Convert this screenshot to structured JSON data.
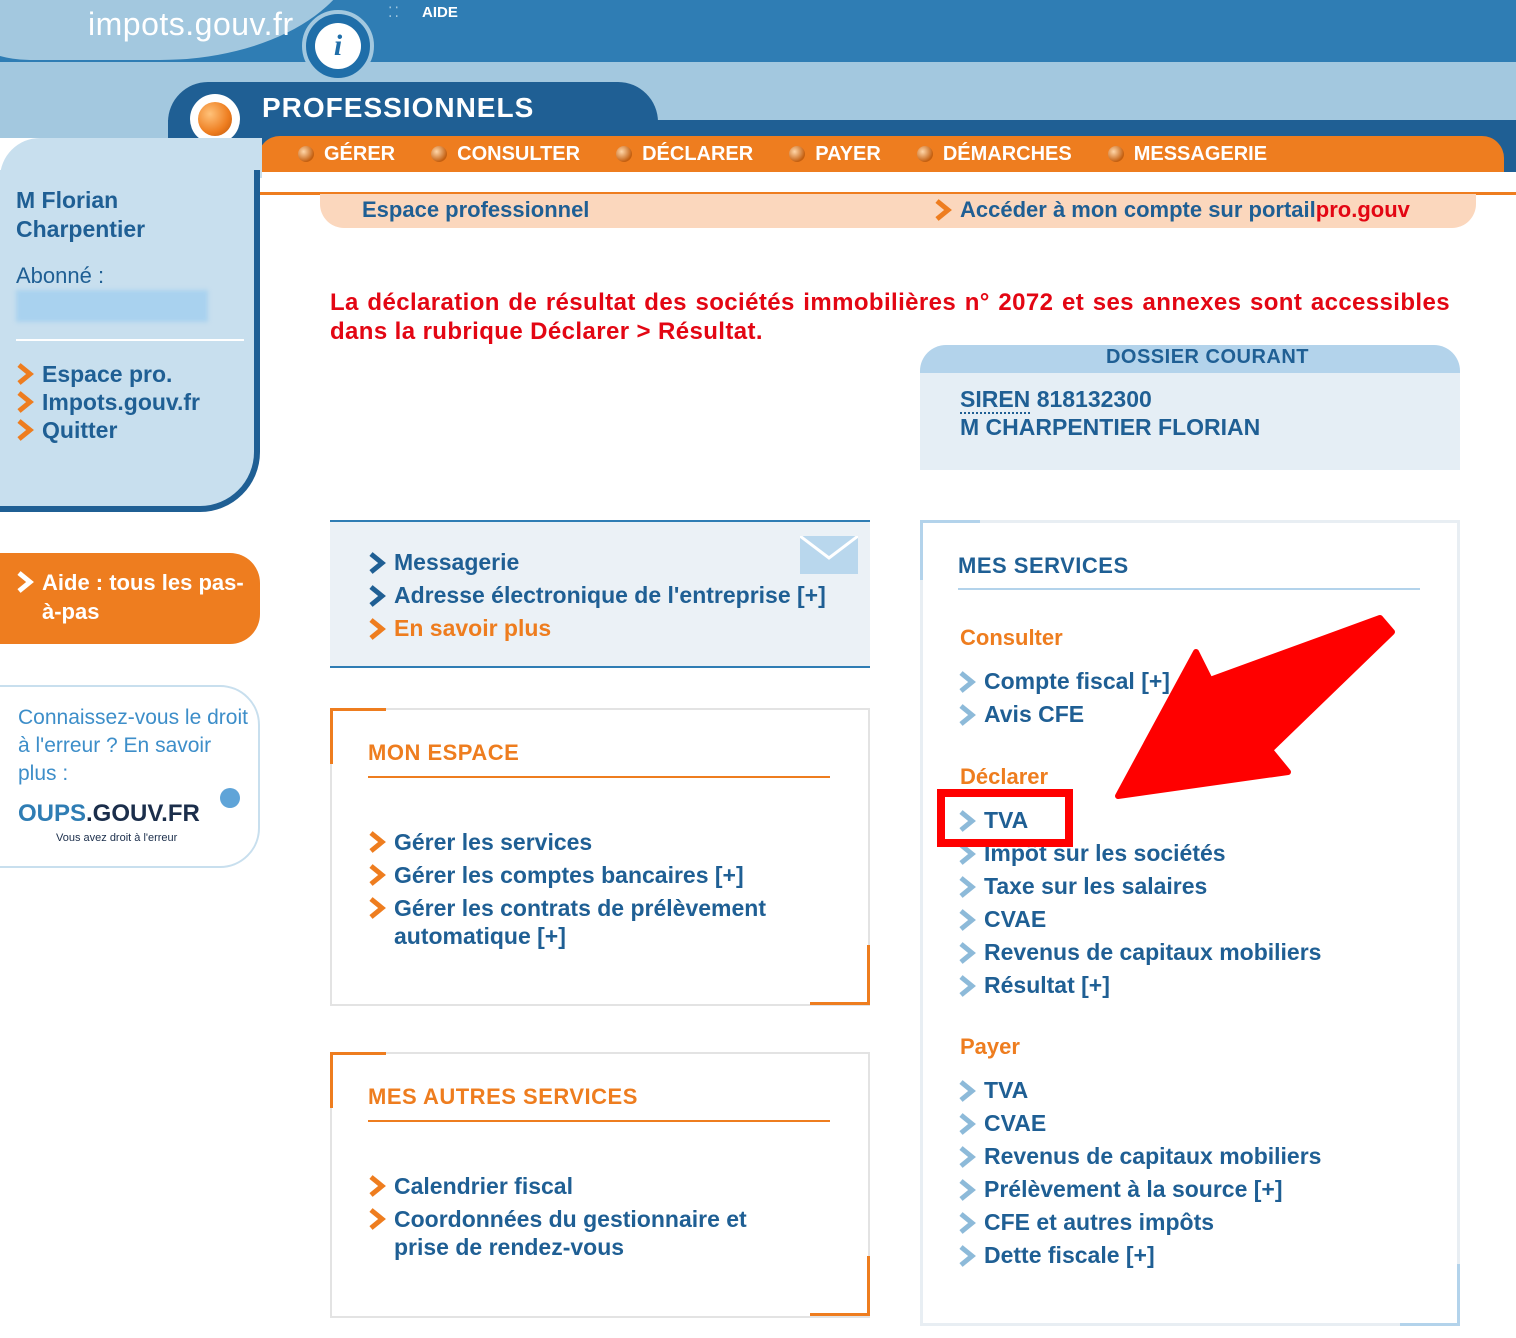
{
  "header": {
    "logo_text": "impots.gouv.fr",
    "info_glyph": "i",
    "aide_label": "AIDE",
    "section_title": "PROFESSIONNELS"
  },
  "nav": {
    "items": [
      {
        "label": "GÉRER"
      },
      {
        "label": "CONSULTER"
      },
      {
        "label": "DÉCLARER"
      },
      {
        "label": "PAYER"
      },
      {
        "label": "DÉMARCHES"
      },
      {
        "label": "MESSAGERIE"
      }
    ]
  },
  "subbar": {
    "espace_label": "Espace professionnel",
    "portail_prefix": "Accéder à mon compte sur portail",
    "portail_suffix": "pro.gouv"
  },
  "sidebar": {
    "user_name": "M  Florian Charpentier",
    "abonne_label": "Abonné :",
    "links": [
      {
        "label": "Espace pro."
      },
      {
        "label": "Impots.gouv.fr"
      },
      {
        "label": "Quitter"
      }
    ],
    "aide_label": "Aide : tous les pas-à-pas",
    "oups_text": "Connaissez-vous le droit à l'erreur ? En savoir plus :",
    "oups_logo_main": "OUPS",
    "oups_logo_domain": ".GOUV.FR",
    "oups_tagline": "Vous avez droit à l'erreur"
  },
  "alert": {
    "text": "La déclaration de résultat des sociétés immobilières n° 2072 et ses annexes sont accessibles dans la rubrique Déclarer > Résultat."
  },
  "messagerie_box": {
    "links": [
      {
        "label": "Messagerie"
      },
      {
        "label": "Adresse électronique de l'entreprise [+]"
      },
      {
        "label": "En savoir plus"
      }
    ]
  },
  "mon_espace": {
    "title": "MON ESPACE",
    "links": [
      {
        "label": "Gérer les services"
      },
      {
        "label": "Gérer les comptes bancaires [+]"
      },
      {
        "label": "Gérer les contrats de prélèvement automatique [+]"
      }
    ]
  },
  "autres_services": {
    "title": "MES AUTRES SERVICES",
    "links": [
      {
        "label": "Calendrier fiscal"
      },
      {
        "label": "Coordonnées du gestionnaire et prise de rendez-vous"
      }
    ]
  },
  "dossier": {
    "title": "DOSSIER COURANT",
    "siren_label": "SIREN",
    "siren_value": "818132300",
    "holder": "M CHARPENTIER FLORIAN"
  },
  "services": {
    "title": "MES SERVICES",
    "groups": [
      {
        "title": "Consulter",
        "items": [
          {
            "label": "Compte fiscal [+]"
          },
          {
            "label": "Avis CFE"
          }
        ]
      },
      {
        "title": "Déclarer",
        "items": [
          {
            "label": "TVA"
          },
          {
            "label": "Impôt sur les sociétés"
          },
          {
            "label": "Taxe sur les salaires"
          },
          {
            "label": "CVAE"
          },
          {
            "label": "Revenus de capitaux mobiliers"
          },
          {
            "label": "Résultat [+]"
          }
        ]
      },
      {
        "title": "Payer",
        "items": [
          {
            "label": "TVA"
          },
          {
            "label": "CVAE"
          },
          {
            "label": "Revenus de capitaux mobiliers"
          },
          {
            "label": "Prélèvement à la source [+]"
          },
          {
            "label": "CFE et autres impôts"
          },
          {
            "label": "Dette fiscale [+]"
          }
        ]
      }
    ]
  },
  "colors": {
    "primary_blue": "#1f5f94",
    "light_blue": "#a3c8df",
    "orange": "#ee7d1f",
    "alert_red": "#e30613",
    "annotation_red": "#ff0000"
  }
}
